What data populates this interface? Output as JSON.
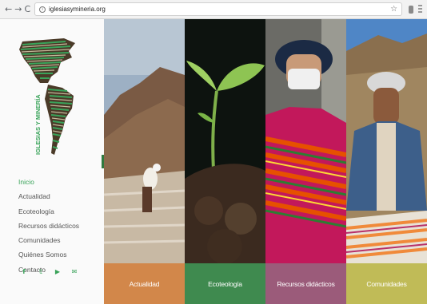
{
  "browser": {
    "url": "iglesiasymineria.org",
    "back_glyph": "←",
    "forward_glyph": "→",
    "reload_glyph": "C",
    "info_glyph": "i",
    "star_glyph": "☆"
  },
  "logo": {
    "text": "IGLESIAS Y MINERÍA",
    "accent_color": "#3aa35a",
    "stripe_color": "#4a3a28"
  },
  "menu": {
    "items": [
      {
        "label": "Inicio",
        "active": true
      },
      {
        "label": "Actualidad",
        "active": false
      },
      {
        "label": "Ecoteología",
        "active": false
      },
      {
        "label": "Recursos didácticos",
        "active": false
      },
      {
        "label": "Comunidades",
        "active": false
      },
      {
        "label": "Quiénes Somos",
        "active": false
      },
      {
        "label": "Contacto",
        "active": false
      }
    ],
    "active_color": "#3aa35a"
  },
  "social": {
    "facebook": "f",
    "twitter": "𝕥",
    "youtube": "▶",
    "email": "✉"
  },
  "panels": [
    {
      "label": "Actualidad",
      "color": "#d2874a"
    },
    {
      "label": "Ecoteología",
      "color": "#3f8a4f"
    },
    {
      "label": "Recursos didácticos",
      "color": "#9b5b7a"
    },
    {
      "label": "Comunidades",
      "color": "#c0bb57"
    }
  ]
}
